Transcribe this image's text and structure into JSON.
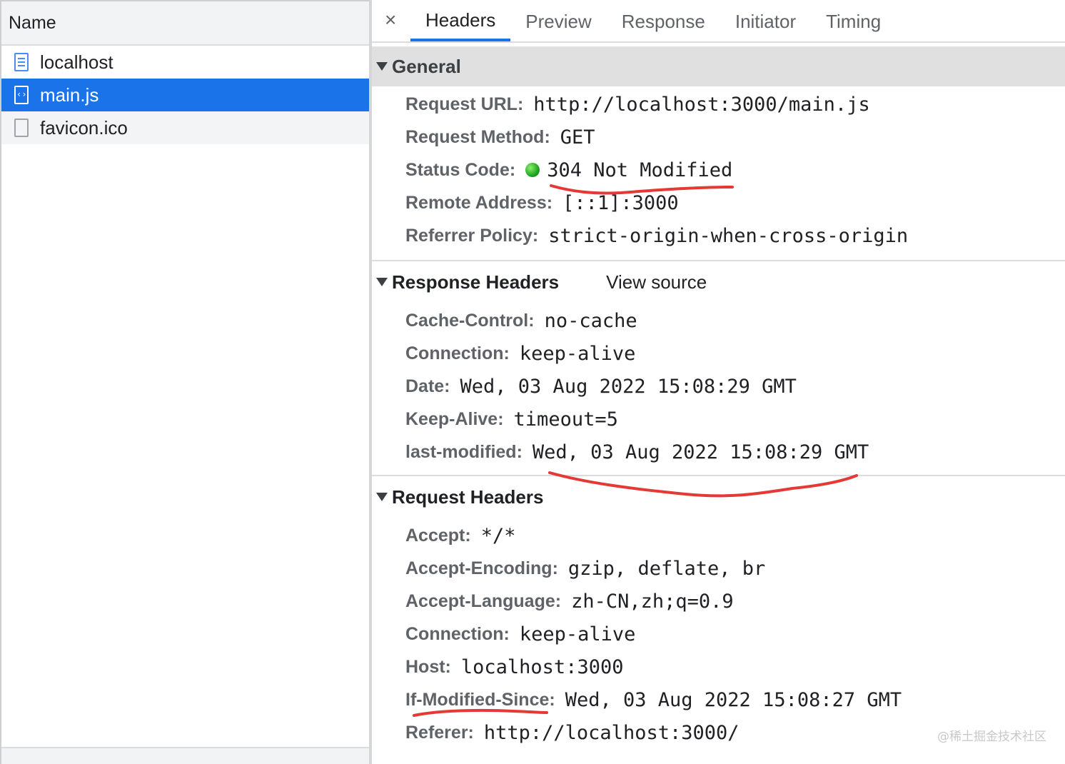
{
  "request_list": {
    "header": "Name",
    "items": [
      {
        "name": "localhost",
        "icon": "document-icon",
        "selected": false
      },
      {
        "name": "main.js",
        "icon": "script-icon",
        "selected": true
      },
      {
        "name": "favicon.ico",
        "icon": "file-icon",
        "selected": false
      }
    ]
  },
  "details": {
    "close_icon": "×",
    "tabs": [
      {
        "label": "Headers",
        "active": true
      },
      {
        "label": "Preview",
        "active": false
      },
      {
        "label": "Response",
        "active": false
      },
      {
        "label": "Initiator",
        "active": false
      },
      {
        "label": "Timing",
        "active": false
      }
    ],
    "general": {
      "title": "General",
      "rows": [
        {
          "name": "Request URL:",
          "value": "http://localhost:3000/main.js"
        },
        {
          "name": "Request Method:",
          "value": "GET"
        },
        {
          "name": "Status Code:",
          "value": "304 Not Modified"
        },
        {
          "name": "Remote Address:",
          "value": "[::1]:3000"
        },
        {
          "name": "Referrer Policy:",
          "value": "strict-origin-when-cross-origin"
        }
      ]
    },
    "response_headers": {
      "title": "Response Headers",
      "view_source": "View source",
      "rows": [
        {
          "name": "Cache-Control:",
          "value": "no-cache"
        },
        {
          "name": "Connection:",
          "value": "keep-alive"
        },
        {
          "name": "Date:",
          "value": "Wed, 03 Aug 2022 15:08:29 GMT"
        },
        {
          "name": "Keep-Alive:",
          "value": "timeout=5"
        },
        {
          "name": "last-modified:",
          "value": "Wed, 03 Aug 2022 15:08:29 GMT"
        }
      ]
    },
    "request_headers": {
      "title": "Request Headers",
      "rows": [
        {
          "name": "Accept:",
          "value": "*/*"
        },
        {
          "name": "Accept-Encoding:",
          "value": "gzip, deflate, br"
        },
        {
          "name": "Accept-Language:",
          "value": "zh-CN,zh;q=0.9"
        },
        {
          "name": "Connection:",
          "value": "keep-alive"
        },
        {
          "name": "Host:",
          "value": "localhost:3000"
        },
        {
          "name": "If-Modified-Since:",
          "value": "Wed, 03 Aug 2022 15:08:27 GMT"
        },
        {
          "name": "Referer:",
          "value": "http://localhost:3000/"
        }
      ]
    }
  },
  "watermark": "@稀土掘金技术社区",
  "colors": {
    "selected_row": "#1a73e8",
    "status_ok": "#1fa41f",
    "annotation": "#e53935"
  }
}
